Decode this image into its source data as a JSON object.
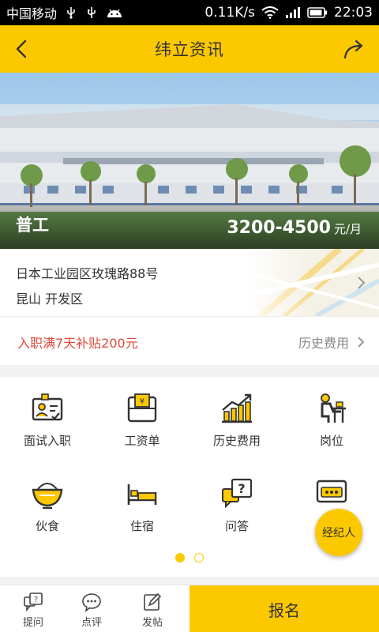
{
  "status_bar": {
    "carrier": "中国移动",
    "speed": "0.11K/s",
    "time": "22:03"
  },
  "header": {
    "title": "纬立资讯"
  },
  "job": {
    "title": "普工",
    "salary": "3200-4500",
    "salary_unit": "元/月"
  },
  "address": {
    "line1": "日本工业园区玫瑰路88号",
    "line2": "昆山  开发区"
  },
  "subsidy": {
    "text": "入职满7天补贴200元",
    "history_link": "历史费用"
  },
  "grid": {
    "items": [
      {
        "label": "面试入职",
        "icon": "interview-icon"
      },
      {
        "label": "工资单",
        "icon": "payslip-icon"
      },
      {
        "label": "历史费用",
        "icon": "history-chart-icon"
      },
      {
        "label": "岗位",
        "icon": "position-icon"
      },
      {
        "label": "伙食",
        "icon": "food-bowl-icon"
      },
      {
        "label": "住宿",
        "icon": "bed-icon"
      },
      {
        "label": "问答",
        "icon": "qa-icon"
      },
      {
        "label": "",
        "icon": "chat-icon"
      }
    ],
    "pages": 2,
    "active_page": 1
  },
  "fab": {
    "label": "经纪人"
  },
  "bottom_bar": {
    "tabs": [
      {
        "label": "提问",
        "icon": "ask-icon"
      },
      {
        "label": "点评",
        "icon": "comment-icon"
      },
      {
        "label": "发帖",
        "icon": "post-icon"
      }
    ],
    "signup_label": "报名"
  },
  "colors": {
    "accent": "#fcc800",
    "subsidy": "#e0493a",
    "status_bar": "#000000"
  }
}
